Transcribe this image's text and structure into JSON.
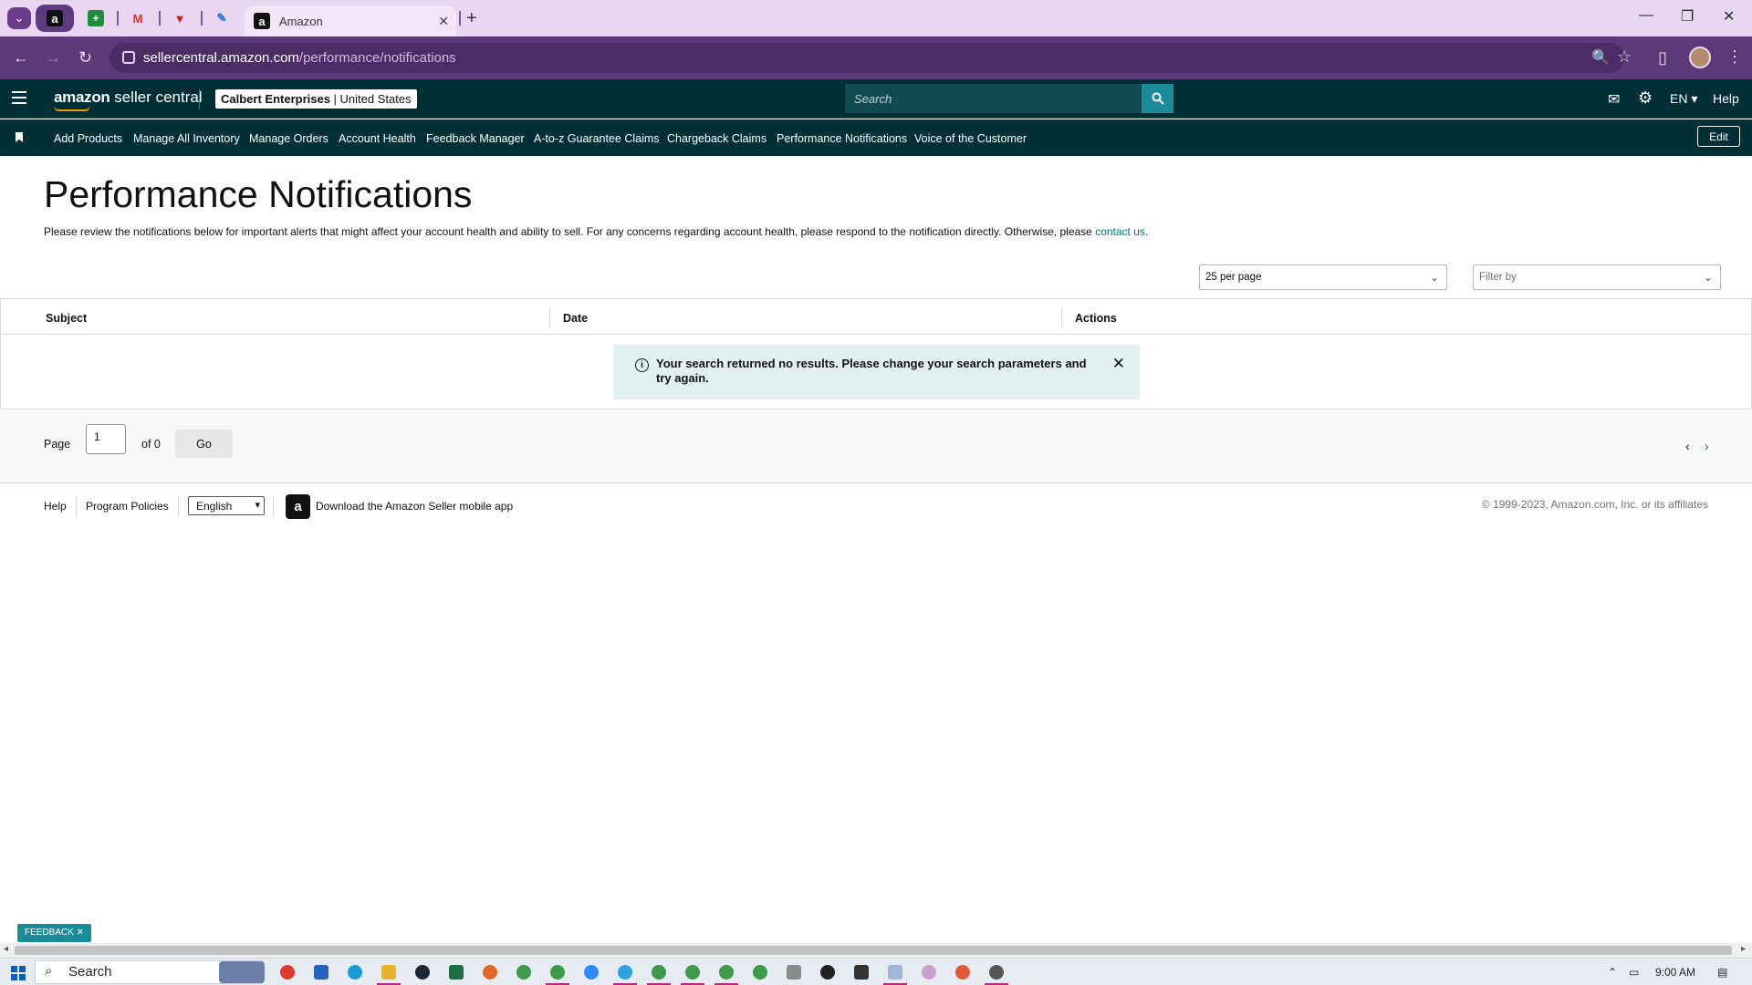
{
  "browser": {
    "tab_title": "Amazon",
    "url_host": "sellercentral.amazon.com",
    "url_path": "/performance/notifications",
    "icons": {
      "tab_menu": "chevron-down-icon",
      "new_tab": "+",
      "minimize": "—",
      "restore": "❐",
      "close": "✕",
      "back": "←",
      "forward": "→",
      "reload": "↻",
      "zoom": "🔍",
      "bookmark": "☆",
      "sidepanel": "▯",
      "menu": "⋮",
      "tab_close": "✕"
    },
    "accent_color": "#5c3a7a"
  },
  "header": {
    "logo_brand": "amazon",
    "logo_suffix": " seller central",
    "account_name": "Calbert Enterprises",
    "account_sep": " | ",
    "marketplace": "United States",
    "search_placeholder": "Search",
    "language": "EN ▾",
    "help": "Help",
    "icons": {
      "mail": "✉",
      "settings": "⚙"
    },
    "brand_color": "#002f36"
  },
  "nav": {
    "items": [
      "Add Products",
      "Manage All Inventory",
      "Manage Orders",
      "Account Health",
      "Feedback Manager",
      "A-to-z Guarantee Claims",
      "Chargeback Claims",
      "Performance Notifications",
      "Voice of the Customer"
    ],
    "edit_label": "Edit"
  },
  "main": {
    "title": "Performance Notifications",
    "description": "Please review the notifications below for important alerts that might affect your account health and ability to sell. For any concerns regarding account health, please respond to the notification directly. Otherwise, please ",
    "contact_link": "contact us.",
    "per_page_selected": "25 per page",
    "filter_placeholder": "Filter by",
    "table": {
      "columns": [
        "Subject",
        "Date",
        "Actions"
      ],
      "rows": []
    },
    "alert": {
      "message": "Your search returned no results. Please change your search parameters and try again.",
      "icon": "i",
      "close": "✕"
    }
  },
  "pagination": {
    "page_label": "Page",
    "page_value": "1",
    "of_label": "of 0",
    "go_label": "Go",
    "prev": "‹",
    "next": "›"
  },
  "footer": {
    "help": "Help",
    "policies": "Program Policies",
    "language": "English",
    "app_text": "Download the Amazon Seller mobile app",
    "app_icon_letter": "a",
    "copyright": "© 1999-2023, Amazon.com, Inc. or its affiliates"
  },
  "feedback": {
    "label": "FEEDBACK ✕"
  },
  "taskbar": {
    "search": "Search",
    "clock": "9:00 AM"
  }
}
